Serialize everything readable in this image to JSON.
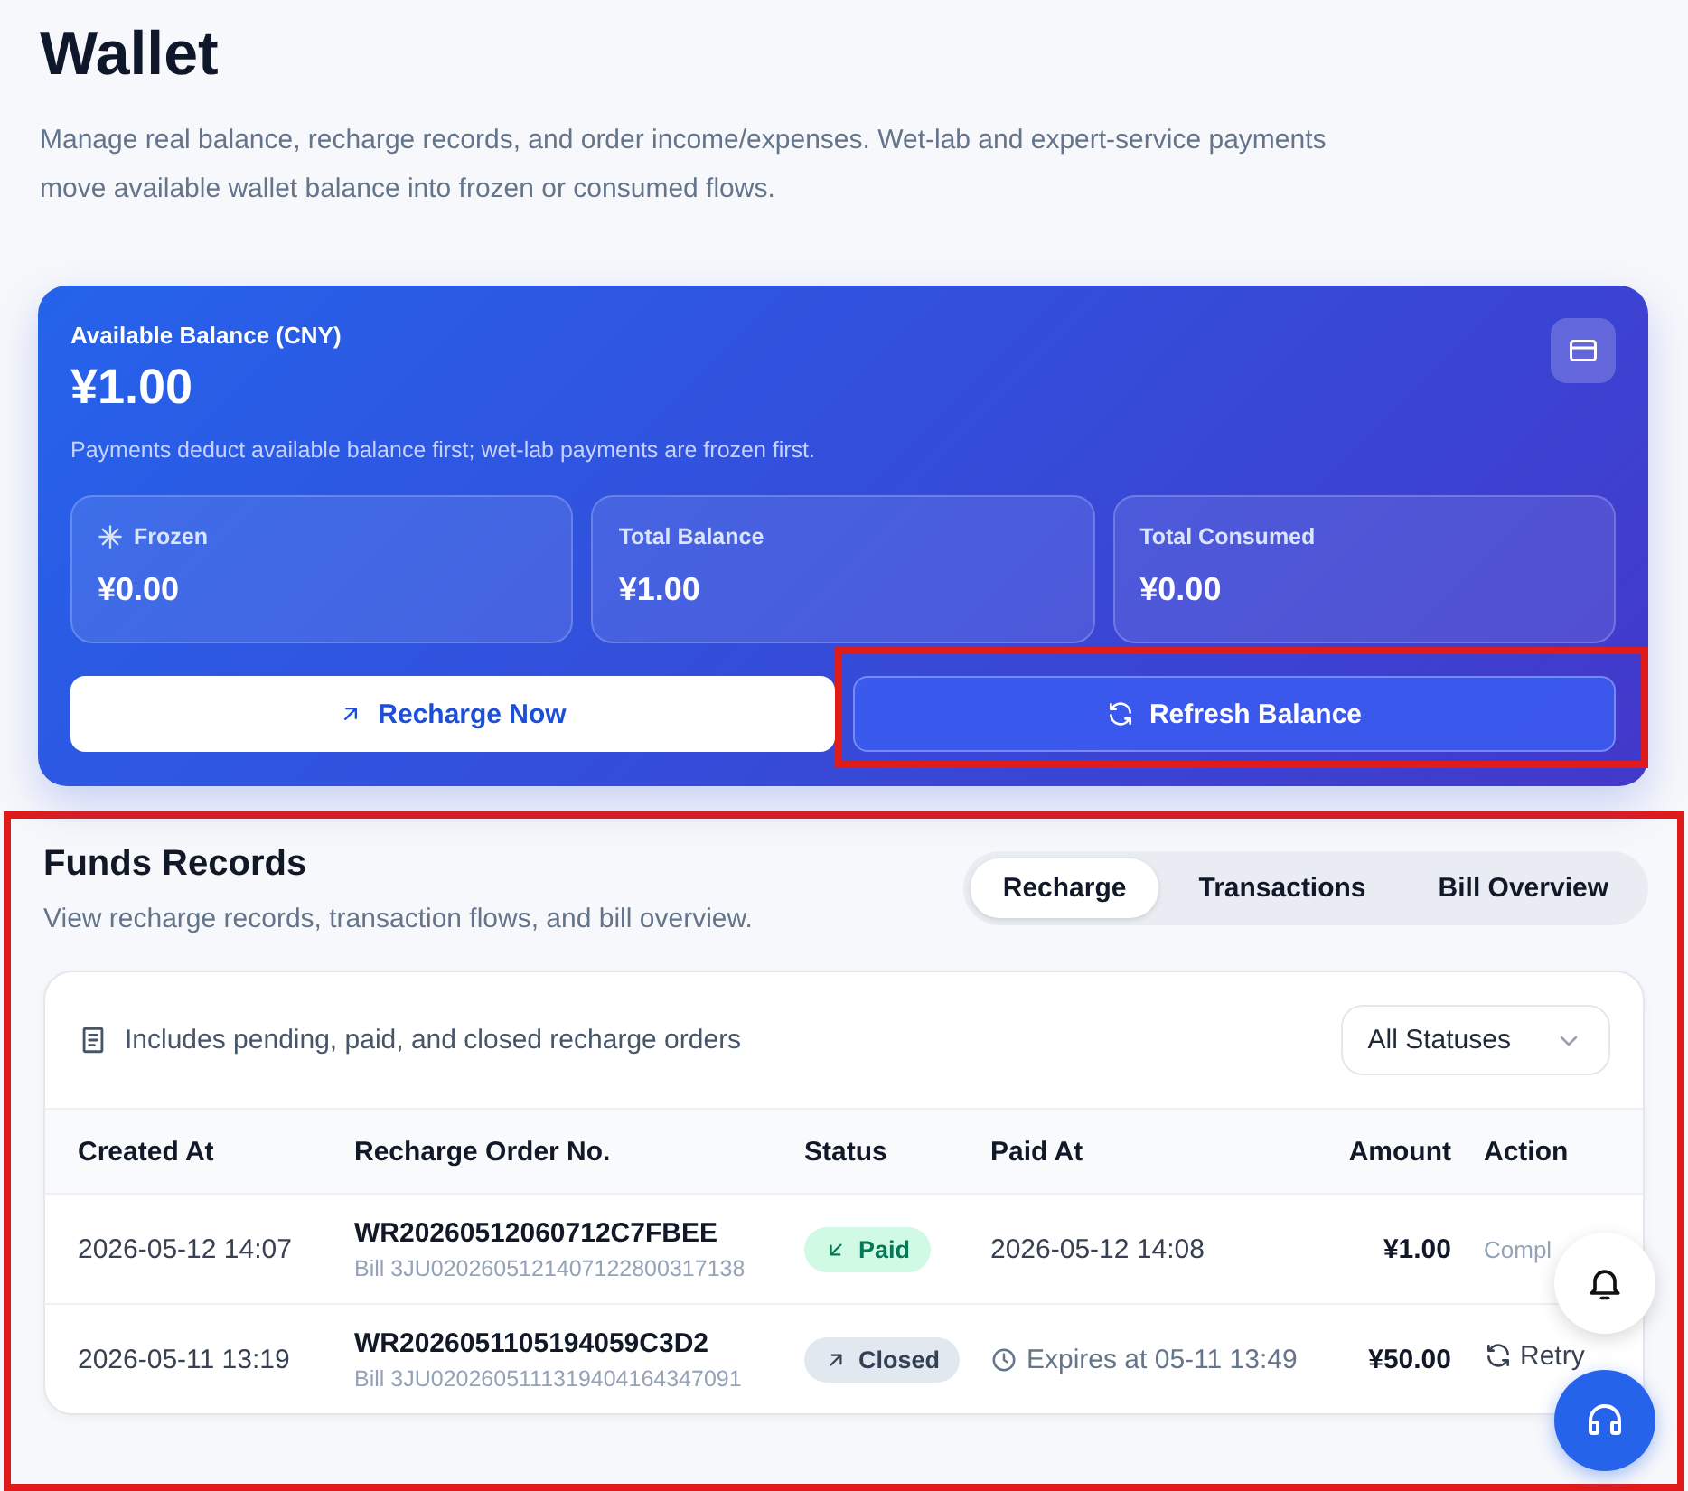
{
  "page": {
    "title": "Wallet",
    "description": "Manage real balance, recharge records, and order income/expenses. Wet-lab and expert-service payments move available wallet balance into frozen or consumed flows."
  },
  "balance_card": {
    "label": "Available Balance (CNY)",
    "amount": "¥1.00",
    "note": "Payments deduct available balance first; wet-lab payments are frozen first.",
    "stats": [
      {
        "kind": "frozen",
        "label": "Frozen",
        "value": "¥0.00"
      },
      {
        "kind": "plain",
        "label": "Total Balance",
        "value": "¥1.00"
      },
      {
        "kind": "plain",
        "label": "Total Consumed",
        "value": "¥0.00"
      }
    ],
    "actions": [
      {
        "kind": "primary",
        "label": "Recharge Now",
        "highlighted": false
      },
      {
        "kind": "refresh",
        "label": "Refresh Balance",
        "highlighted": true
      }
    ]
  },
  "funds": {
    "highlighted": true,
    "title": "Funds Records",
    "subtitle": "View recharge records, transaction flows, and bill overview.",
    "tabs": [
      {
        "label": "Recharge",
        "selected": true
      },
      {
        "label": "Transactions",
        "selected": false
      },
      {
        "label": "Bill Overview",
        "selected": false
      }
    ],
    "filter_note": "Includes pending, paid, and closed recharge orders",
    "status_filter": "All Statuses",
    "columns": [
      "Created At",
      "Recharge Order No.",
      "Status",
      "Paid At",
      "Amount",
      "Action"
    ],
    "rows": [
      {
        "created": "2026-05-12 14:07",
        "order_no": "WR20260512060712C7FBEE",
        "bill": "Bill 3JU0202605121407122800317138",
        "status": {
          "kind": "paid",
          "label": "Paid"
        },
        "paid_at": {
          "kind": "date",
          "text": "2026-05-12 14:08"
        },
        "amount": "¥1.00",
        "action": {
          "kind": "text",
          "label": "Compl"
        }
      },
      {
        "created": "2026-05-11 13:19",
        "order_no": "WR2026051105194059C3D2",
        "bill": "Bill 3JU0202605111319404164347091",
        "status": {
          "kind": "closed",
          "label": "Closed"
        },
        "paid_at": {
          "kind": "expiry",
          "text": "Expires at 05-11 13:49"
        },
        "amount": "¥50.00",
        "action": {
          "kind": "retry",
          "label": "Retry"
        }
      }
    ]
  }
}
